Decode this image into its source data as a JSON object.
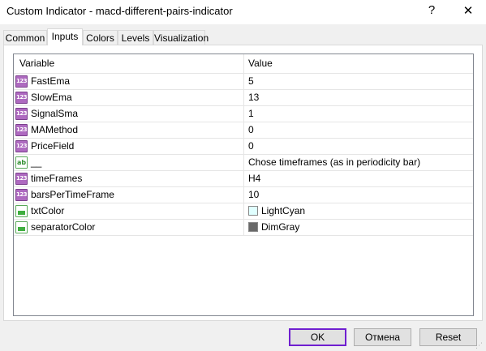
{
  "window": {
    "title": "Custom Indicator - macd-different-pairs-indicator",
    "help_glyph": "?",
    "close_glyph": "✕"
  },
  "tabs": [
    {
      "label": "Common",
      "active": false
    },
    {
      "label": "Inputs",
      "active": true
    },
    {
      "label": "Colors",
      "active": false
    },
    {
      "label": "Levels",
      "active": false
    },
    {
      "label": "Visualization",
      "active": false
    }
  ],
  "grid": {
    "columns": {
      "variable": "Variable",
      "value": "Value"
    },
    "icons": {
      "num": "123",
      "str": "ab"
    },
    "rows": [
      {
        "icon": "number-icon",
        "type": "num",
        "variable": "FastEma",
        "value": "5"
      },
      {
        "icon": "number-icon",
        "type": "num",
        "variable": "SlowEma",
        "value": "13"
      },
      {
        "icon": "number-icon",
        "type": "num",
        "variable": "SignalSma",
        "value": "1"
      },
      {
        "icon": "number-icon",
        "type": "num",
        "variable": "MAMethod",
        "value": "0"
      },
      {
        "icon": "number-icon",
        "type": "num",
        "variable": "PriceField",
        "value": "0"
      },
      {
        "icon": "string-icon",
        "type": "str",
        "variable": "__",
        "value": "Chose timeframes (as in periodicity bar)"
      },
      {
        "icon": "number-icon",
        "type": "num",
        "variable": "timeFrames",
        "value": "H4"
      },
      {
        "icon": "number-icon",
        "type": "num",
        "variable": "barsPerTimeFrame",
        "value": "10"
      },
      {
        "icon": "color-icon",
        "type": "color",
        "variable": "txtColor",
        "value": "LightCyan",
        "swatch": "#E0FFFF"
      },
      {
        "icon": "color-icon",
        "type": "color",
        "variable": "separatorColor",
        "value": "DimGray",
        "swatch": "#696969"
      }
    ]
  },
  "buttons": {
    "ok": "OK",
    "cancel": "Отмена",
    "reset": "Reset"
  },
  "colors": {
    "accent_border": "#6F1FD0",
    "number_icon": "#AE6AC0",
    "color_icon": "#3FAE3F"
  }
}
